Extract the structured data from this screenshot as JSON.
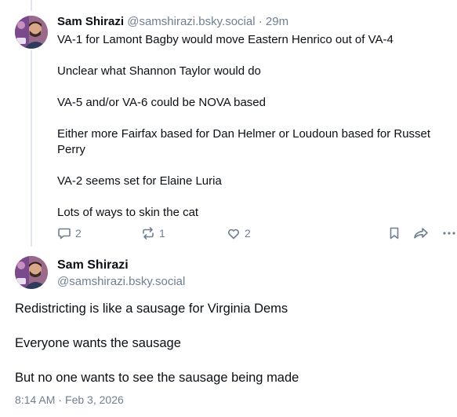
{
  "post1": {
    "author_name": "Sam Shirazi",
    "author_handle": "@samshirazi.bsky.social",
    "separator": "·",
    "age": "29m",
    "paragraphs": [
      "VA-1 for Lamont Bagby would move Eastern Henrico out of VA-4",
      "Unclear what Shannon Taylor would do",
      "VA-5 and/or VA-6 could be NOVA based",
      "Either more Fairfax based for Dan Helmer or Loudoun based for Russet Perry",
      "VA-2 seems set for Elaine Luria",
      "Lots of ways to skin the cat"
    ],
    "reply_count": "2",
    "repost_count": "1",
    "like_count": "2"
  },
  "post2": {
    "author_name": "Sam Shirazi",
    "author_handle": "@samshirazi.bsky.social",
    "paragraphs": [
      "Redistricting is like a sausage for Virginia Dems",
      "Everyone wants the sausage",
      "But no one wants to see the sausage being made"
    ],
    "time": "8:14 AM",
    "separator": "·",
    "date": "Feb 3, 2026"
  },
  "icons": {
    "reply": "speech-bubble-icon",
    "repost": "repost-arrows-icon",
    "like": "heart-icon",
    "bookmark": "bookmark-icon",
    "share": "share-arrow-icon",
    "more": "more-dots-icon"
  },
  "colors": {
    "text": "#0b0f14",
    "muted": "#6f7f92",
    "thread_line": "#e2e7ee",
    "avatar_bg": "#8a5a78"
  }
}
